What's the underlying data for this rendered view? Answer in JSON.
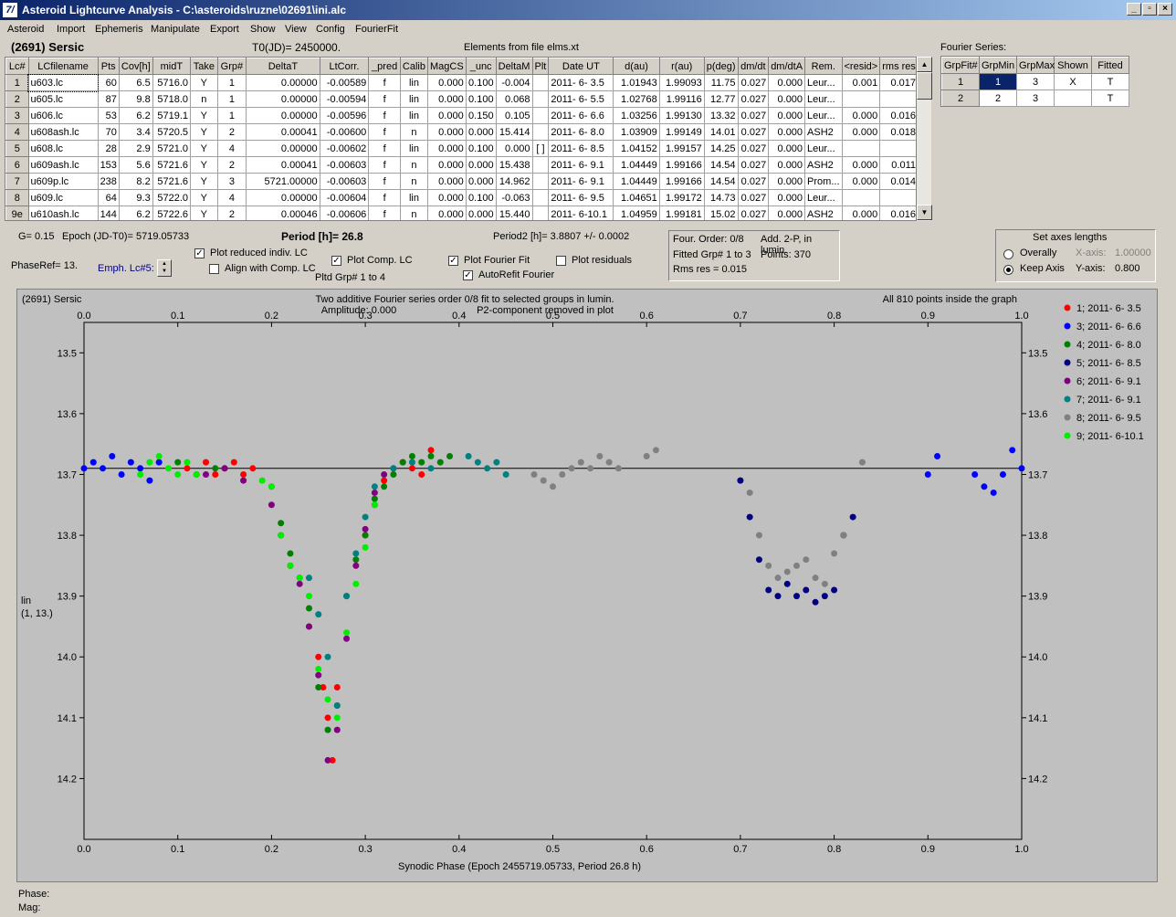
{
  "window": {
    "title": "Asteroid Lightcurve Analysis - C:\\asteroids\\ruzne\\02691\\ini.alc",
    "icon": "7/",
    "min": "_",
    "max": "▫",
    "close": "×"
  },
  "menu": [
    "Asteroid",
    "Import",
    "Ephemeris",
    "Manipulate",
    "Export",
    "Show",
    "View",
    "Config",
    "FourierFit"
  ],
  "header": {
    "asteroid": "(2691) Sersic",
    "t0": "T0(JD)= 2450000.",
    "elements": "Elements from file elms.xt"
  },
  "table": {
    "columns": [
      "Lc#",
      "LCfilename",
      "Pts",
      "Cov[h]",
      "midT",
      "Take",
      "Grp#",
      "DeltaT",
      "LtCorr.",
      "_pred",
      "Calib",
      "MagCS",
      "_unc",
      "DeltaM",
      "Plt",
      "Date UT",
      "d(au)",
      "r(au)",
      "p(deg)",
      "dm/dt",
      "dm/dtA",
      "Rem.",
      "<resid>",
      "rms res"
    ],
    "rows": [
      [
        "1",
        "u603.lc",
        "60",
        "6.5",
        "5716.0",
        "Y",
        "1",
        "0.00000",
        "-0.00589",
        "f",
        "lin",
        "0.000",
        "0.100",
        "-0.004",
        "",
        "2011- 6- 3.5",
        "1.01943",
        "1.99093",
        "11.75",
        "0.027",
        "0.000",
        "Leur...",
        "0.001",
        "0.017"
      ],
      [
        "2",
        "u605.lc",
        "87",
        "9.8",
        "5718.0",
        "n",
        "1",
        "0.00000",
        "-0.00594",
        "f",
        "lin",
        "0.000",
        "0.100",
        "0.068",
        "",
        "2011- 6- 5.5",
        "1.02768",
        "1.99116",
        "12.77",
        "0.027",
        "0.000",
        "Leur...",
        "",
        ""
      ],
      [
        "3",
        "u606.lc",
        "53",
        "6.2",
        "5719.1",
        "Y",
        "1",
        "0.00000",
        "-0.00596",
        "f",
        "lin",
        "0.000",
        "0.150",
        "0.105",
        "",
        "2011- 6- 6.6",
        "1.03256",
        "1.99130",
        "13.32",
        "0.027",
        "0.000",
        "Leur...",
        "0.000",
        "0.016"
      ],
      [
        "4",
        "u608ash.lc",
        "70",
        "3.4",
        "5720.5",
        "Y",
        "2",
        "0.00041",
        "-0.00600",
        "f",
        "n",
        "0.000",
        "0.000",
        "15.414",
        "",
        "2011- 6- 8.0",
        "1.03909",
        "1.99149",
        "14.01",
        "0.027",
        "0.000",
        "ASH2",
        "0.000",
        "0.018"
      ],
      [
        "5",
        "u608.lc",
        "28",
        "2.9",
        "5721.0",
        "Y",
        "4",
        "0.00000",
        "-0.00602",
        "f",
        "lin",
        "0.000",
        "0.100",
        "0.000",
        "[ ]",
        "2011- 6- 8.5",
        "1.04152",
        "1.99157",
        "14.25",
        "0.027",
        "0.000",
        "Leur...",
        "",
        ""
      ],
      [
        "6",
        "u609ash.lc",
        "153",
        "5.6",
        "5721.6",
        "Y",
        "2",
        "0.00041",
        "-0.00603",
        "f",
        "n",
        "0.000",
        "0.000",
        "15.438",
        "",
        "2011- 6- 9.1",
        "1.04449",
        "1.99166",
        "14.54",
        "0.027",
        "0.000",
        "ASH2",
        "0.000",
        "0.011"
      ],
      [
        "7",
        "u609p.lc",
        "238",
        "8.2",
        "5721.6",
        "Y",
        "3",
        "5721.00000",
        "-0.00603",
        "f",
        "n",
        "0.000",
        "0.000",
        "14.962",
        "",
        "2011- 6- 9.1",
        "1.04449",
        "1.99166",
        "14.54",
        "0.027",
        "0.000",
        "Prom...",
        "0.000",
        "0.014"
      ],
      [
        "8",
        "u609.lc",
        "64",
        "9.3",
        "5722.0",
        "Y",
        "4",
        "0.00000",
        "-0.00604",
        "f",
        "lin",
        "0.000",
        "0.100",
        "-0.063",
        "",
        "2011- 6- 9.5",
        "1.04651",
        "1.99172",
        "14.73",
        "0.027",
        "0.000",
        "Leur...",
        "",
        ""
      ],
      [
        "9e",
        "u610ash.lc",
        "144",
        "6.2",
        "5722.6",
        "Y",
        "2",
        "0.00046",
        "-0.00606",
        "f",
        "n",
        "0.000",
        "0.000",
        "15.440",
        "",
        "2011- 6-10.1",
        "1.04959",
        "1.99181",
        "15.02",
        "0.027",
        "0.000",
        "ASH2",
        "0.000",
        "0.016"
      ]
    ]
  },
  "fourier": {
    "title": "Fourier Series:",
    "columns": [
      "GrpFit#",
      "GrpMin",
      "GrpMax",
      "Shown",
      "Fitted"
    ],
    "rows": [
      [
        "1",
        "1",
        "3",
        "X",
        "T"
      ],
      [
        "2",
        "2",
        "3",
        "",
        "T"
      ]
    ]
  },
  "controls": {
    "g": "G= 0.15",
    "epoch": "Epoch (JD-T0)= 5719.05733",
    "period": "Period [h]= 26.8",
    "period2": "Period2 [h]= 3.8807 +/- 0.0002",
    "phaseref": "PhaseRef= 13.",
    "emph": "Emph. Lc#5:",
    "plot_reduced": "Plot reduced indiv. LC",
    "align": "Align with Comp. LC",
    "plot_comp": "Plot Comp. LC",
    "pltd": "Pltd Grp#  1   to   4",
    "plot_fourier": "Plot Fourier Fit",
    "autorefit": "AutoRefit Fourier",
    "plot_resid": "Plot residuals",
    "info": {
      "l1a": "Four. Order:  0/8",
      "l1b": "Add. 2-P, in lumin.",
      "l2a": "Fitted Grp# 1 to 3",
      "l2b": "Points: 370",
      "l3": "Rms res     = 0.015"
    },
    "axes": {
      "title": "Set axes lengths",
      "overall": "Overally",
      "keep": "Keep Axis",
      "xaxis": "X-axis:",
      "xval": "1.00000",
      "yaxis": "Y-axis:",
      "yval": "0.800"
    }
  },
  "status": {
    "phase": "Phase:",
    "mag": "Mag:"
  },
  "chart_data": {
    "type": "scatter",
    "name_label": "(2691) Sersic",
    "title": "Two additive Fourier series order 0/8 fit to selected groups in lumin.",
    "subtitle_a": "Amplitude: 0.000",
    "subtitle_b": "P2-component removed in plot",
    "note": "All 810 points inside the graph",
    "xlabel": "Synodic Phase (Epoch 2455719.05733, Period 26.8 h)",
    "ylabel": "lin",
    "ylabel2": "(1, 13.)",
    "xlim": [
      0.0,
      1.0
    ],
    "ylim": [
      13.45,
      14.3
    ],
    "x_ticks": [
      0.0,
      0.1,
      0.2,
      0.3,
      0.4,
      0.5,
      0.6,
      0.7,
      0.8,
      0.9,
      1.0
    ],
    "x_tick_labels": [
      "0.0",
      "0.1",
      "0.2",
      "0.3",
      "0.4",
      "0.5",
      "0.6",
      "0.7",
      "0.8",
      "0.9",
      "1.0"
    ],
    "y_ticks": [
      13.5,
      13.6,
      13.7,
      13.8,
      13.9,
      14.0,
      14.1,
      14.2
    ],
    "y_tick_labels": [
      "13.5",
      "13.6",
      "13.7",
      "13.8",
      "13.9",
      "14.0",
      "14.1",
      "14.2"
    ],
    "fit_line_y": 13.69,
    "series": [
      {
        "name": "1; 2011- 6- 3.5",
        "color": "#ff0000",
        "x": [
          0.11,
          0.12,
          0.13,
          0.14,
          0.15,
          0.16,
          0.17,
          0.18,
          0.24,
          0.25,
          0.255,
          0.26,
          0.265,
          0.27,
          0.3,
          0.31,
          0.32,
          0.33,
          0.34,
          0.35,
          0.36,
          0.37
        ],
        "y": [
          13.69,
          13.7,
          13.68,
          13.7,
          13.69,
          13.68,
          13.7,
          13.69,
          13.95,
          14.0,
          14.05,
          14.1,
          14.17,
          14.05,
          13.8,
          13.75,
          13.71,
          13.69,
          13.68,
          13.69,
          13.7,
          13.66
        ]
      },
      {
        "name": "3; 2011- 6- 6.6",
        "color": "#0000ff",
        "x": [
          0.0,
          0.01,
          0.02,
          0.03,
          0.04,
          0.05,
          0.06,
          0.07,
          0.08,
          0.9,
          0.91,
          0.95,
          0.96,
          0.97,
          0.98,
          0.99,
          1.0
        ],
        "y": [
          13.69,
          13.68,
          13.69,
          13.67,
          13.7,
          13.68,
          13.69,
          13.71,
          13.68,
          13.7,
          13.67,
          13.7,
          13.72,
          13.73,
          13.7,
          13.66,
          13.69
        ]
      },
      {
        "name": "4; 2011- 6- 8.0",
        "color": "#008000",
        "x": [
          0.1,
          0.14,
          0.2,
          0.21,
          0.22,
          0.23,
          0.24,
          0.25,
          0.26,
          0.27,
          0.28,
          0.29,
          0.3,
          0.31,
          0.32,
          0.33,
          0.34,
          0.35,
          0.36,
          0.37,
          0.38,
          0.39
        ],
        "y": [
          13.68,
          13.69,
          13.72,
          13.78,
          13.83,
          13.87,
          13.92,
          14.05,
          14.12,
          14.08,
          13.9,
          13.84,
          13.8,
          13.74,
          13.72,
          13.7,
          13.68,
          13.67,
          13.68,
          13.67,
          13.68,
          13.67
        ]
      },
      {
        "name": "5; 2011- 6- 8.5",
        "color": "#000080",
        "x": [
          0.7,
          0.71,
          0.72,
          0.73,
          0.74,
          0.75,
          0.76,
          0.77,
          0.78,
          0.79,
          0.8,
          0.81,
          0.82
        ],
        "y": [
          13.71,
          13.77,
          13.84,
          13.89,
          13.9,
          13.88,
          13.9,
          13.89,
          13.91,
          13.9,
          13.89,
          13.8,
          13.77
        ]
      },
      {
        "name": "6; 2011- 6- 9.1",
        "color": "#800080",
        "x": [
          0.13,
          0.15,
          0.17,
          0.2,
          0.21,
          0.22,
          0.23,
          0.24,
          0.25,
          0.26,
          0.27,
          0.28,
          0.29,
          0.3,
          0.31,
          0.32
        ],
        "y": [
          13.7,
          13.69,
          13.71,
          13.75,
          13.8,
          13.85,
          13.88,
          13.95,
          14.03,
          14.17,
          14.12,
          13.97,
          13.85,
          13.79,
          13.73,
          13.7
        ]
      },
      {
        "name": "7; 2011- 6- 9.1",
        "color": "#008080",
        "x": [
          0.24,
          0.25,
          0.26,
          0.27,
          0.28,
          0.29,
          0.3,
          0.31,
          0.33,
          0.35,
          0.37,
          0.41,
          0.42,
          0.43,
          0.44,
          0.45
        ],
        "y": [
          13.87,
          13.93,
          14.0,
          14.08,
          13.9,
          13.83,
          13.77,
          13.72,
          13.69,
          13.68,
          13.69,
          13.67,
          13.68,
          13.69,
          13.68,
          13.7
        ]
      },
      {
        "name": "8; 2011- 6- 9.5",
        "color": "#808080",
        "x": [
          0.48,
          0.49,
          0.5,
          0.51,
          0.52,
          0.53,
          0.54,
          0.55,
          0.56,
          0.57,
          0.6,
          0.61,
          0.71,
          0.72,
          0.73,
          0.74,
          0.75,
          0.76,
          0.77,
          0.78,
          0.79,
          0.8,
          0.81,
          0.83
        ],
        "y": [
          13.7,
          13.71,
          13.72,
          13.7,
          13.69,
          13.68,
          13.69,
          13.67,
          13.68,
          13.69,
          13.67,
          13.66,
          13.73,
          13.8,
          13.85,
          13.87,
          13.86,
          13.85,
          13.84,
          13.87,
          13.88,
          13.83,
          13.8,
          13.68
        ]
      },
      {
        "name": "9; 2011- 6-10.1",
        "color": "#00ee00",
        "x": [
          0.06,
          0.07,
          0.08,
          0.09,
          0.1,
          0.11,
          0.12,
          0.19,
          0.2,
          0.21,
          0.22,
          0.23,
          0.24,
          0.25,
          0.26,
          0.27,
          0.28,
          0.29,
          0.3,
          0.31
        ],
        "y": [
          13.7,
          13.68,
          13.67,
          13.69,
          13.7,
          13.68,
          13.7,
          13.71,
          13.72,
          13.8,
          13.85,
          13.87,
          13.9,
          14.02,
          14.07,
          14.1,
          13.96,
          13.88,
          13.82,
          13.75
        ]
      }
    ]
  }
}
